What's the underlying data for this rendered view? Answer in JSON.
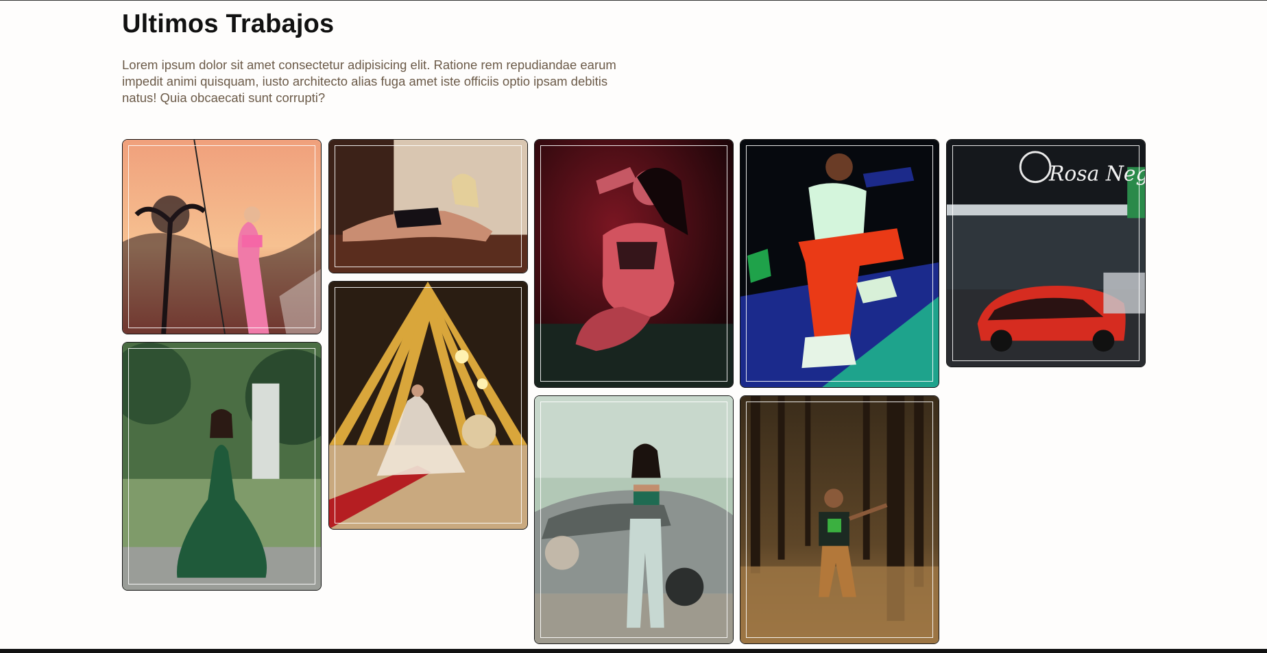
{
  "section": {
    "title": "Ultimos Trabajos",
    "description": "Lorem ipsum dolor sit amet consectetur adipisicing elit. Ratione rem repudiandae earum impedit animi quisquam, iusto architecto alias fuga amet iste officiis optio ipsam debitis natus! Quia obcaecati sunt corrupti?"
  },
  "gallery": {
    "photos": [
      {
        "subject": "woman in pink outfit at sunset",
        "palette": [
          "#f7a27a",
          "#f6c08f",
          "#e97a5d"
        ]
      },
      {
        "subject": "woman in black lingerie lying on floor",
        "palette": [
          "#2a1712",
          "#d8c3ad",
          "#6b3a2a"
        ]
      },
      {
        "subject": "woman in green gown in garden",
        "palette": [
          "#35563a",
          "#9bb57e",
          "#1f4a30"
        ]
      },
      {
        "subject": "bride under golden arched canopy",
        "palette": [
          "#2a1d12",
          "#d9a63b",
          "#c9a97f"
        ]
      },
      {
        "subject": "woman in red lighting on dark backdrop",
        "palette": [
          "#3a0b12",
          "#c23a4a",
          "#1a0508"
        ]
      },
      {
        "subject": "woman leaning on silver car",
        "palette": [
          "#a8c0ae",
          "#8e9591",
          "#d8e2dc"
        ]
      },
      {
        "subject": "man in orange pants by pool at night",
        "palette": [
          "#0a0f16",
          "#1c2fa0",
          "#1fa28a"
        ]
      },
      {
        "subject": "boy posing between trees in forest",
        "palette": [
          "#4d3a22",
          "#a98150",
          "#2c2115"
        ]
      },
      {
        "subject": "red sports car outside Rosa Negra club",
        "palette": [
          "#1a1d22",
          "#3a434a",
          "#d42c20"
        ]
      }
    ],
    "sign_text": "Rosa Negra"
  },
  "colors": {
    "background": "#fefdfc",
    "title": "#111111",
    "description": "#6b5a48",
    "card_border": "#111111"
  }
}
